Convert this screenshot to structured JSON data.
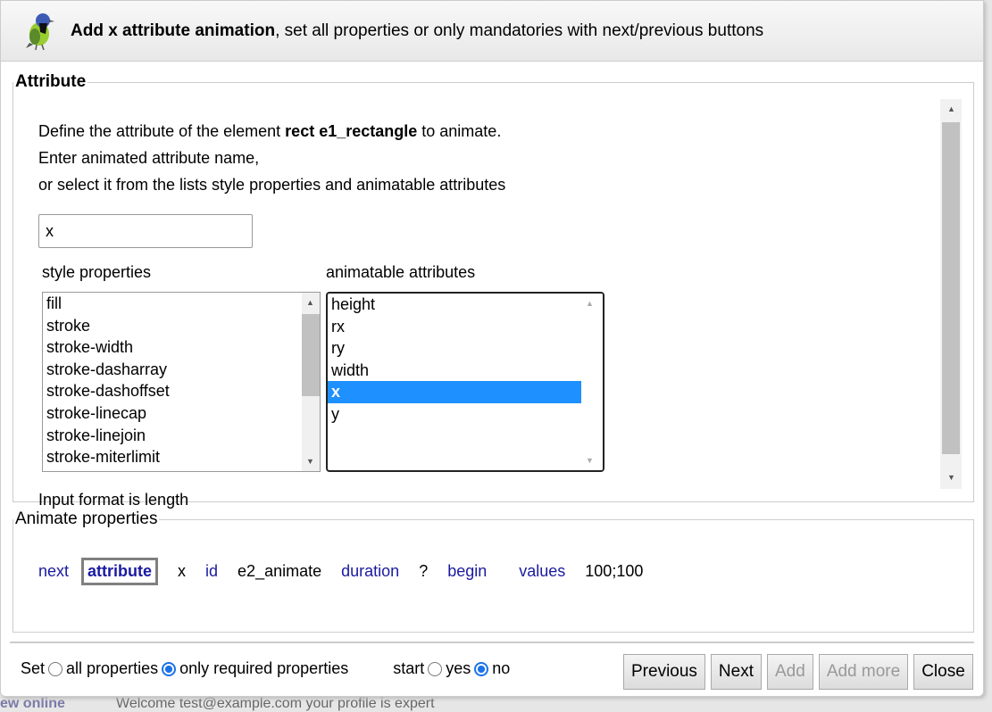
{
  "background": {
    "left_text": "ew online",
    "welcome": "Welcome test@example.com your profile is expert"
  },
  "header": {
    "title_bold": "Add x attribute animation",
    "title_rest": ", set all properties or only mandatories with next/previous buttons",
    "icon": "bird-logo"
  },
  "attribute": {
    "legend": "Attribute",
    "line1_pre": "Define the attribute of the element ",
    "line1_bold": "rect e1_rectangle",
    "line1_post": " to animate.",
    "line2": "Enter animated attribute name,",
    "line3": "or select it from the lists style properties and animatable attributes",
    "input_value": "x",
    "style_label": "style properties",
    "style_items": [
      "fill",
      "stroke",
      "stroke-width",
      "stroke-dasharray",
      "stroke-dashoffset",
      "stroke-linecap",
      "stroke-linejoin",
      "stroke-miterlimit"
    ],
    "anim_label": "animatable attributes",
    "anim_items": [
      "height",
      "rx",
      "ry",
      "width",
      "x",
      "y"
    ],
    "anim_selected": "x",
    "format": "Input format is length"
  },
  "animate": {
    "legend": "Animate properties",
    "next": "next",
    "attribute": "attribute",
    "attr_value": "x",
    "id_label": "id",
    "id_value": "e2_animate",
    "duration_label": "duration",
    "duration_value": "?",
    "begin_label": "begin",
    "values_label": "values",
    "values_value": "100;100"
  },
  "footer": {
    "set_label": "Set",
    "all_label": "all properties",
    "required_label": "only required properties",
    "set_selected": "only required properties",
    "start_label": "start",
    "yes_label": "yes",
    "no_label": "no",
    "start_selected": "no"
  },
  "buttons": {
    "previous": "Previous",
    "next": "Next",
    "add": "Add",
    "add_more": "Add more",
    "close": "Close"
  },
  "colors": {
    "selection": "#1e90ff",
    "link": "#1a1aa0",
    "radio": "#1a73e8"
  }
}
